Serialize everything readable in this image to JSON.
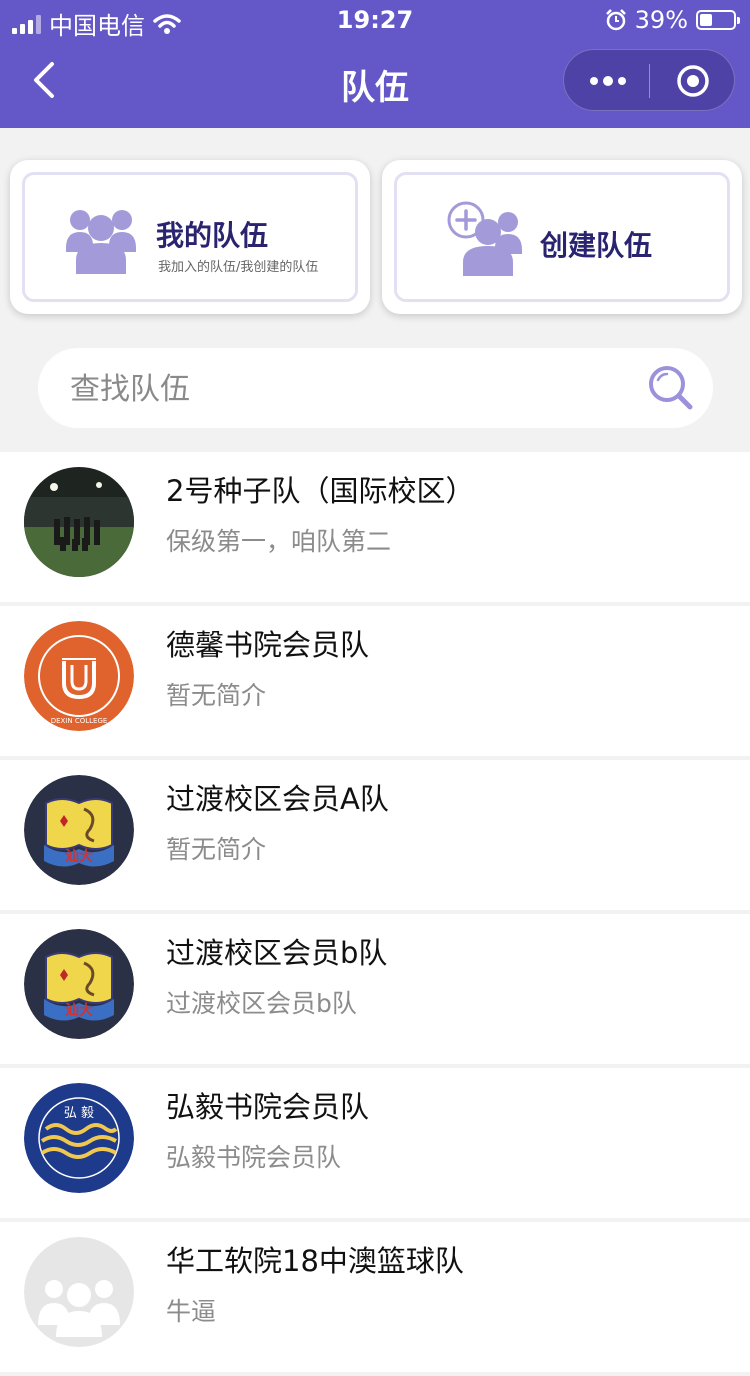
{
  "status_bar": {
    "carrier": "中国电信",
    "time": "19:27",
    "battery": "39%",
    "battery_level": 0.39
  },
  "navbar": {
    "title": "队伍",
    "back_icon": "chevron-left-icon",
    "more_icon": "more-dots-icon",
    "close_icon": "target-icon"
  },
  "cards": {
    "my_teams": {
      "title": "我的队伍",
      "subtitle": "我加入的队伍/我创建的队伍",
      "icon": "team-icon"
    },
    "create_team": {
      "title": "创建队伍",
      "icon": "add-team-icon"
    }
  },
  "search": {
    "placeholder": "查找队伍",
    "icon": "search-icon"
  },
  "teams": [
    {
      "name": "2号种子队（国际校区）",
      "desc": "保级第一，咱队第二",
      "avatar": "photo"
    },
    {
      "name": "德馨书院会员队",
      "desc": "暂无简介",
      "avatar": "dexin-logo",
      "logo_text": "DEXIN COLLEGE"
    },
    {
      "name": "过渡校区会员A队",
      "desc": "暂无简介",
      "avatar": "stu-emblem",
      "logo_text": "汕大"
    },
    {
      "name": "过渡校区会员b队",
      "desc": "过渡校区会员b队",
      "avatar": "stu-emblem",
      "logo_text": "汕大"
    },
    {
      "name": "弘毅书院会员队",
      "desc": "弘毅书院会员队",
      "avatar": "hongyi-logo",
      "logo_text": "弘 毅"
    },
    {
      "name": "华工软院18中澳篮球队",
      "desc": "牛逼",
      "avatar": "placeholder"
    }
  ],
  "colors": {
    "header": "#6457c8",
    "accent": "#9c92dc",
    "card_title": "#2a2470"
  }
}
